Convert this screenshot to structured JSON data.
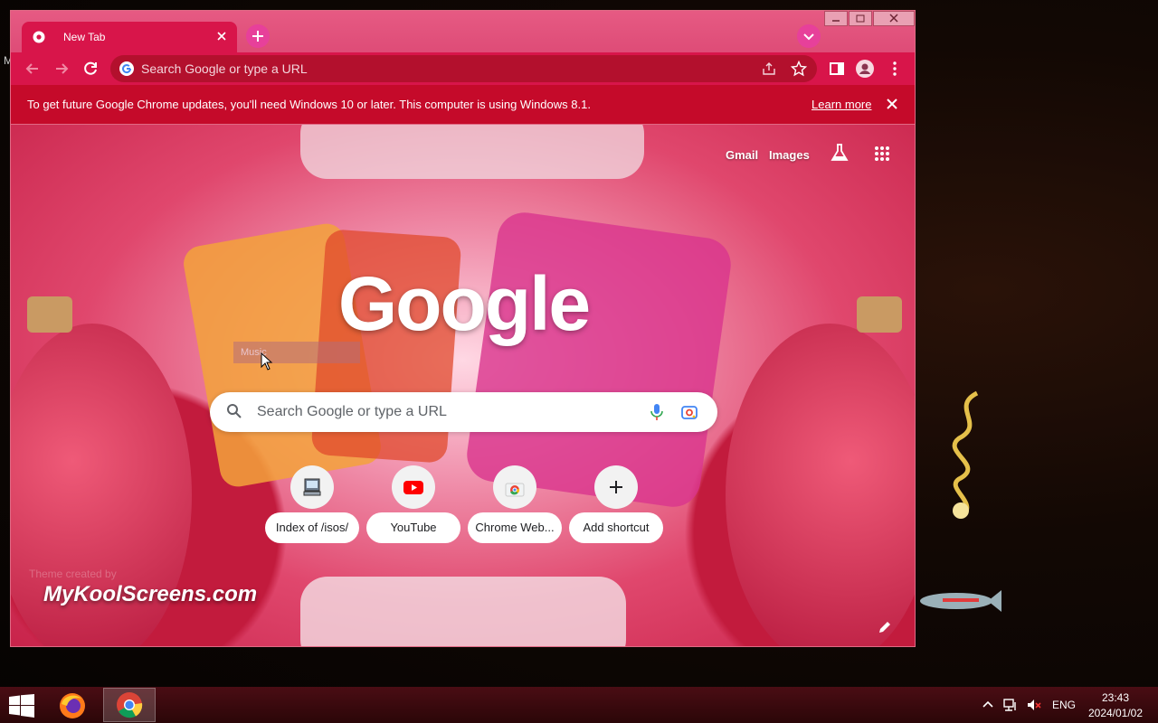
{
  "desktop": {
    "edge_letter": "M"
  },
  "browser": {
    "tab": {
      "title": "New Tab"
    },
    "omnibox": {
      "placeholder": "Search Google or type a URL"
    },
    "infobar": {
      "message": "To get future Google Chrome updates, you'll need Windows 10 or later. This computer is using Windows 8.1.",
      "learn_more": "Learn more"
    }
  },
  "ntp": {
    "links": {
      "gmail": "Gmail",
      "images": "Images"
    },
    "logo": "Google",
    "tooltip": "Music",
    "search_placeholder": "Search Google or type a URL",
    "shortcuts": [
      {
        "label": "Index of /isos/",
        "icon": "computer-icon"
      },
      {
        "label": "YouTube",
        "icon": "youtube-icon"
      },
      {
        "label": "Chrome Web...",
        "icon": "chrome-web-store-icon"
      },
      {
        "label": "Add shortcut",
        "icon": "plus-icon"
      }
    ],
    "ghost_text": "Theme created by",
    "watermark": "MyKoolScreens.com"
  },
  "taskbar": {
    "language": "ENG",
    "time": "23:43",
    "date": "2024/01/02"
  },
  "colors": {
    "frame": "#de4c77",
    "toolbar": "#d8154a",
    "infobar": "#c50a2a",
    "taskbar": "#3a090e"
  }
}
